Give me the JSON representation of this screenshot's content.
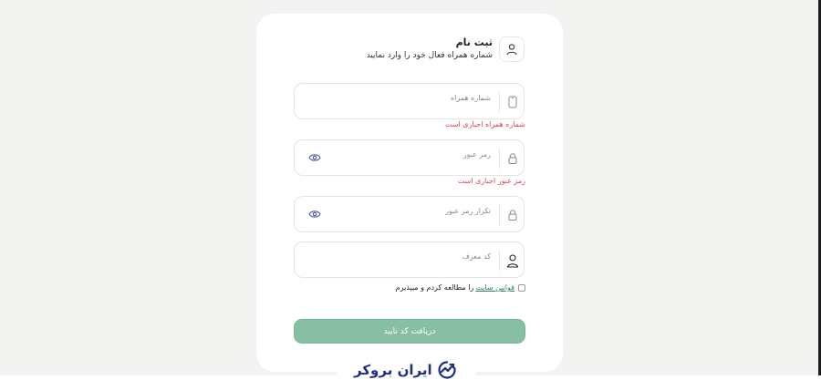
{
  "form": {
    "title": "ثبت نام",
    "subtitle": "شماره همراه فعال خود را وارد نمایید",
    "phone": {
      "placeholder": "شماره همراه",
      "error": "شماره همراه اجباری است",
      "icon": "mobile-icon"
    },
    "password": {
      "placeholder": "رمز عبور",
      "error": "رمز عبور اجباری است",
      "icon": "lock-icon",
      "toggle_icon": "eye-icon"
    },
    "password_confirm": {
      "placeholder": "تکرار رمز عبور",
      "icon": "lock-icon",
      "toggle_icon": "eye-icon"
    },
    "referral": {
      "placeholder": "کد معرف",
      "icon": "user-icon"
    },
    "terms": {
      "link_text": "قوانین سایت",
      "rest_text": "را مطالعه کردم و میپذیرم",
      "checked": false
    },
    "submit_label": "دریافت کد تایید",
    "header_icon": "user-icon"
  },
  "brand": {
    "name": "ایران بروکر",
    "color": "#1e2f86",
    "accent": "#87bfa4",
    "error_color": "#e0405a"
  }
}
